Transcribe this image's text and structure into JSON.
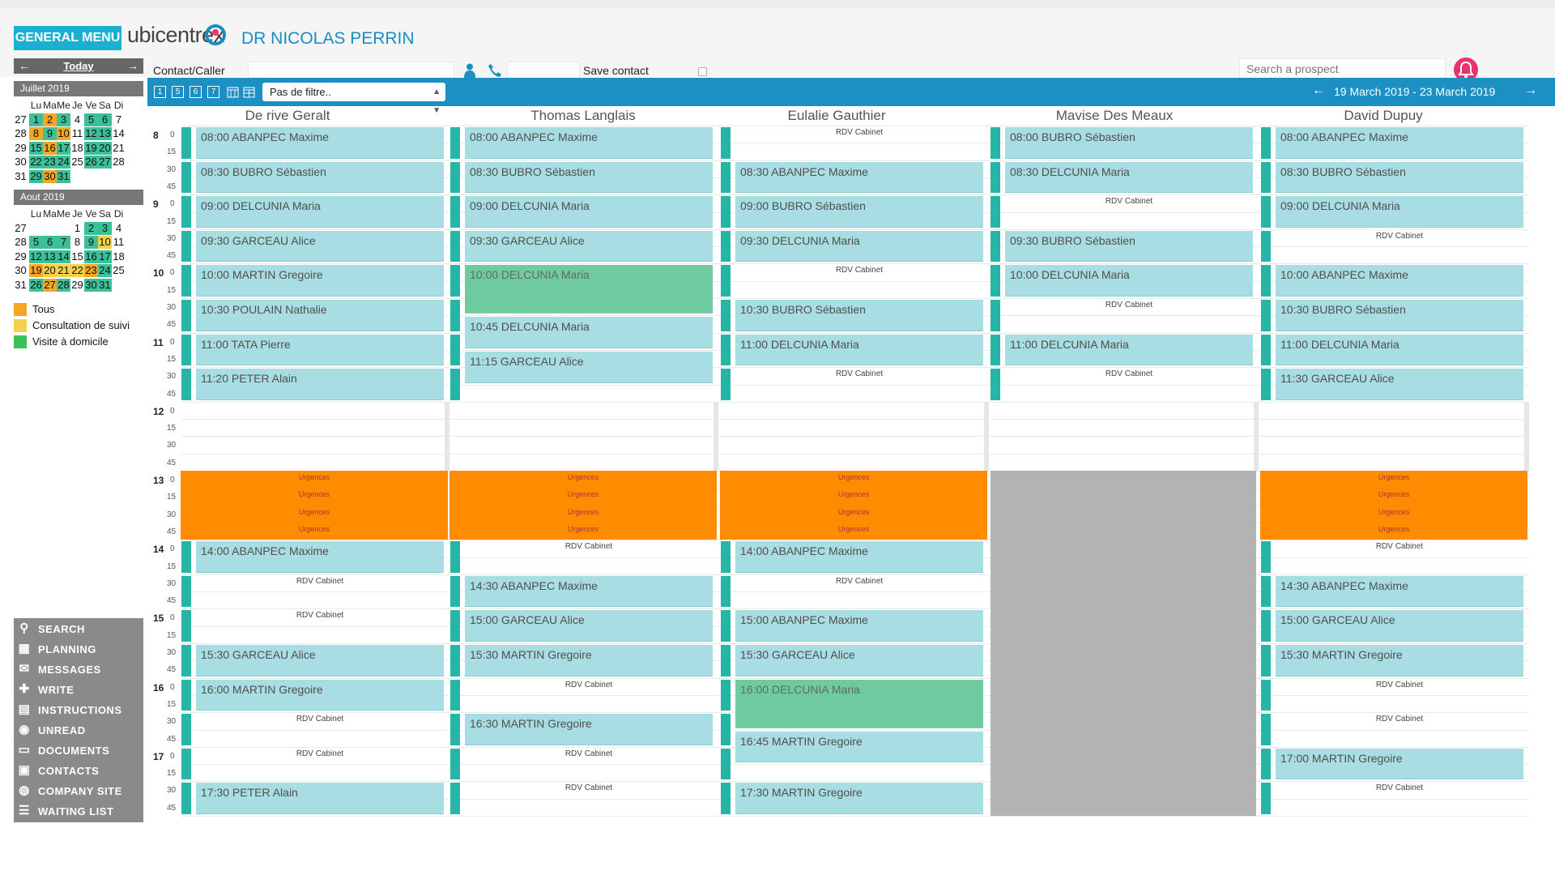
{
  "header": {
    "general_menu": "GENERAL MENU",
    "logo": "ubicentrex",
    "doctor": "DR NICOLAS PERRIN",
    "contact_label": "Contact/Caller",
    "save_contact": "Save contact",
    "search_placeholder": "Search a prospect"
  },
  "mini_nav": {
    "prev": "←",
    "today": "Today",
    "next": "→"
  },
  "calendar": {
    "weekdays": [
      "Lu",
      "Ma",
      "Me",
      "Je",
      "Ve",
      "Sa",
      "Di"
    ],
    "months": [
      {
        "title": "Juillet 2019",
        "weeks": [
          [
            [
              "27",
              ""
            ],
            [
              "1",
              "g"
            ],
            [
              "2",
              "o"
            ],
            [
              "3",
              "g"
            ],
            [
              "4",
              ""
            ],
            [
              "5",
              "g"
            ],
            [
              "6",
              "g"
            ],
            [
              "7",
              ""
            ]
          ],
          [
            [
              "28",
              ""
            ],
            [
              "8",
              "o"
            ],
            [
              "9",
              "g"
            ],
            [
              "10",
              "o"
            ],
            [
              "11",
              ""
            ],
            [
              "12",
              "g"
            ],
            [
              "13",
              "g"
            ],
            [
              "14",
              ""
            ]
          ],
          [
            [
              "29",
              ""
            ],
            [
              "15",
              "g"
            ],
            [
              "16",
              "o"
            ],
            [
              "17",
              "g"
            ],
            [
              "18",
              ""
            ],
            [
              "19",
              "g"
            ],
            [
              "20",
              "g"
            ],
            [
              "21",
              ""
            ]
          ],
          [
            [
              "30",
              ""
            ],
            [
              "22",
              "g"
            ],
            [
              "23",
              "g"
            ],
            [
              "24",
              "g"
            ],
            [
              "25",
              ""
            ],
            [
              "26",
              "g"
            ],
            [
              "27",
              "g"
            ],
            [
              "28",
              ""
            ]
          ],
          [
            [
              "31",
              ""
            ],
            [
              "29",
              "g"
            ],
            [
              "30",
              "o"
            ],
            [
              "31",
              "g"
            ],
            [
              "",
              ""
            ],
            [
              "",
              ""
            ],
            [
              "",
              ""
            ],
            [
              "",
              ""
            ]
          ]
        ]
      },
      {
        "title": "Aout 2019",
        "weeks": [
          [
            [
              "27",
              ""
            ],
            [
              "",
              ""
            ],
            [
              "",
              ""
            ],
            [
              "",
              ""
            ],
            [
              "1",
              ""
            ],
            [
              "2",
              "g"
            ],
            [
              "3",
              "g"
            ],
            [
              "4",
              ""
            ]
          ],
          [
            [
              "28",
              ""
            ],
            [
              "5",
              "g"
            ],
            [
              "6",
              "g"
            ],
            [
              "7",
              "g"
            ],
            [
              "8",
              ""
            ],
            [
              "9",
              "g"
            ],
            [
              "10",
              "y"
            ],
            [
              "11",
              ""
            ]
          ],
          [
            [
              "29",
              ""
            ],
            [
              "12",
              "g"
            ],
            [
              "13",
              "g"
            ],
            [
              "14",
              "g"
            ],
            [
              "15",
              ""
            ],
            [
              "16",
              "g"
            ],
            [
              "17",
              "g"
            ],
            [
              "18",
              ""
            ]
          ],
          [
            [
              "30",
              ""
            ],
            [
              "19",
              "o"
            ],
            [
              "20",
              "y"
            ],
            [
              "21",
              "y"
            ],
            [
              "22",
              "y"
            ],
            [
              "23",
              "o"
            ],
            [
              "24",
              "g"
            ],
            [
              "25",
              ""
            ]
          ],
          [
            [
              "31",
              ""
            ],
            [
              "26",
              "g"
            ],
            [
              "27",
              "o"
            ],
            [
              "28",
              "g"
            ],
            [
              "29",
              ""
            ],
            [
              "30",
              "g"
            ],
            [
              "31",
              "g"
            ],
            [
              "",
              ""
            ]
          ]
        ]
      }
    ]
  },
  "legend": [
    {
      "label": "Tous",
      "color": "#f5a623"
    },
    {
      "label": "Consultation de suivi",
      "color": "#f5d04a"
    },
    {
      "label": "Visite à domicile",
      "color": "#3cc05a"
    }
  ],
  "side_menu": [
    {
      "label": "SEARCH",
      "icon": "search-icon",
      "glyph": "⚲"
    },
    {
      "label": "PLANNING",
      "icon": "calendar-icon",
      "glyph": "▦"
    },
    {
      "label": "MESSAGES",
      "icon": "envelope-icon",
      "glyph": "✉"
    },
    {
      "label": "WRITE",
      "icon": "plus-icon",
      "glyph": "✚"
    },
    {
      "label": "INSTRUCTIONS",
      "icon": "book-icon",
      "glyph": "▤"
    },
    {
      "label": "UNREAD",
      "icon": "circle-icon",
      "glyph": "◉"
    },
    {
      "label": "DOCUMENTS",
      "icon": "inbox-icon",
      "glyph": "▭"
    },
    {
      "label": "CONTACTS",
      "icon": "contact-card-icon",
      "glyph": "▣"
    },
    {
      "label": "COMPANY SITE",
      "icon": "globe-icon",
      "glyph": "◍"
    },
    {
      "label": "WAITING LIST",
      "icon": "list-icon",
      "glyph": "☰"
    }
  ],
  "toolbar": {
    "views": [
      "1",
      "5",
      "6",
      "7"
    ],
    "filter": "Pas de filtre..",
    "range": "19 March 2019 - 23 March 2019",
    "prev": "←",
    "next": "→"
  },
  "time_axis": {
    "hours": [
      "8",
      "9",
      "10",
      "11",
      "12",
      "13",
      "14",
      "15",
      "16",
      "17"
    ],
    "minutes": [
      "0",
      "15",
      "30",
      "45"
    ]
  },
  "columns": [
    {
      "name": "De rive Geralt",
      "appointments": [
        {
          "t": 0,
          "d": 2,
          "label": "08:00 ABANPEC Maxime"
        },
        {
          "t": 2,
          "d": 2,
          "label": "08:30 BUBRO Sébastien"
        },
        {
          "t": 4,
          "d": 2,
          "label": "09:00 DELCUNIA Maria"
        },
        {
          "t": 6,
          "d": 2,
          "label": "09:30 GARCEAU Alice"
        },
        {
          "t": 8,
          "d": 2,
          "label": "10:00 MARTIN Gregoire"
        },
        {
          "t": 10,
          "d": 2,
          "label": "10:30 POULAIN Nathalie"
        },
        {
          "t": 12,
          "d": 2,
          "label": "11:00 TATA Pierre"
        },
        {
          "t": 14,
          "d": 2,
          "label": "11:20 PETER Alain"
        },
        {
          "t": 24,
          "d": 2,
          "label": "14:00 ABANPEC Maxime"
        },
        {
          "t": 30,
          "d": 2,
          "label": "15:30 GARCEAU Alice"
        },
        {
          "t": 32,
          "d": 2,
          "label": "16:00 MARTIN Gregoire"
        },
        {
          "t": 38,
          "d": 2,
          "label": "17:30 PETER Alain"
        }
      ],
      "rdv": [
        26,
        28,
        34,
        36
      ],
      "urgences": true
    },
    {
      "name": "Thomas Langlais",
      "appointments": [
        {
          "t": 0,
          "d": 2,
          "label": "08:00 ABANPEC Maxime"
        },
        {
          "t": 2,
          "d": 2,
          "label": "08:30 BUBRO Sébastien"
        },
        {
          "t": 4,
          "d": 2,
          "label": "09:00 DELCUNIA Maria"
        },
        {
          "t": 6,
          "d": 2,
          "label": "09:30 GARCEAU Alice"
        },
        {
          "t": 8,
          "d": 3,
          "label": "10:00 DELCUNIA Maria",
          "green": true
        },
        {
          "t": 11,
          "d": 2,
          "label": "10:45 DELCUNIA Maria"
        },
        {
          "t": 13,
          "d": 2,
          "label": "11:15 GARCEAU Alice"
        },
        {
          "t": 26,
          "d": 2,
          "label": "14:30 ABANPEC Maxime"
        },
        {
          "t": 28,
          "d": 2,
          "label": "15:00 GARCEAU Alice"
        },
        {
          "t": 30,
          "d": 2,
          "label": "15:30 MARTIN Gregoire"
        },
        {
          "t": 34,
          "d": 2,
          "label": "16:30 MARTIN Gregoire"
        }
      ],
      "rdv": [
        24,
        32,
        36,
        38
      ],
      "urgences": true
    },
    {
      "name": "Eulalie Gauthier",
      "appointments": [
        {
          "t": 2,
          "d": 2,
          "label": "08:30 ABANPEC Maxime"
        },
        {
          "t": 4,
          "d": 2,
          "label": "09:00 BUBRO Sébastien"
        },
        {
          "t": 6,
          "d": 2,
          "label": "09:30 DELCUNIA Maria"
        },
        {
          "t": 10,
          "d": 2,
          "label": "10:30 BUBRO Sébastien"
        },
        {
          "t": 12,
          "d": 2,
          "label": "11:00 DELCUNIA Maria"
        },
        {
          "t": 24,
          "d": 2,
          "label": "14:00 ABANPEC Maxime"
        },
        {
          "t": 28,
          "d": 2,
          "label": "15:00 ABANPEC Maxime"
        },
        {
          "t": 30,
          "d": 2,
          "label": "15:30 GARCEAU Alice"
        },
        {
          "t": 32,
          "d": 3,
          "label": "16:00 DELCUNIA Maria",
          "green": true
        },
        {
          "t": 35,
          "d": 2,
          "label": "16:45 MARTIN Gregoire"
        },
        {
          "t": 38,
          "d": 2,
          "label": "17:30 MARTIN Gregoire"
        }
      ],
      "rdv": [
        0,
        8,
        14,
        26
      ],
      "urgences": true
    },
    {
      "name": "Mavise Des Meaux",
      "appointments": [
        {
          "t": 0,
          "d": 2,
          "label": "08:00 BUBRO Sébastien"
        },
        {
          "t": 2,
          "d": 2,
          "label": "08:30 DELCUNIA Maria"
        },
        {
          "t": 6,
          "d": 2,
          "label": "09:30 BUBRO Sébastien"
        },
        {
          "t": 8,
          "d": 2,
          "label": "10:00 DELCUNIA Maria"
        },
        {
          "t": 12,
          "d": 2,
          "label": "11:00 DELCUNIA Maria"
        }
      ],
      "rdv": [
        4,
        10,
        14
      ],
      "urgences": false
    },
    {
      "name": "David Dupuy",
      "appointments": [
        {
          "t": 0,
          "d": 2,
          "label": "08:00 ABANPEC Maxime"
        },
        {
          "t": 2,
          "d": 2,
          "label": "08:30 BUBRO Sébastien"
        },
        {
          "t": 4,
          "d": 2,
          "label": "09:00 DELCUNIA Maria"
        },
        {
          "t": 8,
          "d": 2,
          "label": "10:00 ABANPEC Maxime"
        },
        {
          "t": 10,
          "d": 2,
          "label": "10:30 BUBRO Sébastien"
        },
        {
          "t": 12,
          "d": 2,
          "label": "11:00 DELCUNIA Maria"
        },
        {
          "t": 14,
          "d": 2,
          "label": "11:30 GARCEAU Alice"
        },
        {
          "t": 26,
          "d": 2,
          "label": "14:30 ABANPEC Maxime"
        },
        {
          "t": 28,
          "d": 2,
          "label": "15:00 GARCEAU Alice"
        },
        {
          "t": 30,
          "d": 2,
          "label": "15:30 MARTIN Gregoire"
        },
        {
          "t": 36,
          "d": 2,
          "label": "17:00 MARTIN Gregoire"
        }
      ],
      "rdv": [
        6,
        24,
        32,
        34,
        38
      ],
      "urgences": true
    }
  ],
  "rdv_label": "RDV Cabinet",
  "urgences_label": "Urgences",
  "colors": {
    "accent": "#1c8fc3",
    "menu_button": "#1ab0cf",
    "appointment": "#a8dde3",
    "appointment_green": "#6fcb9f",
    "urgences": "#ff8c00",
    "marker": "#26b5a7",
    "unavailable": "#b3b3b3",
    "bell": "#e8336a"
  }
}
